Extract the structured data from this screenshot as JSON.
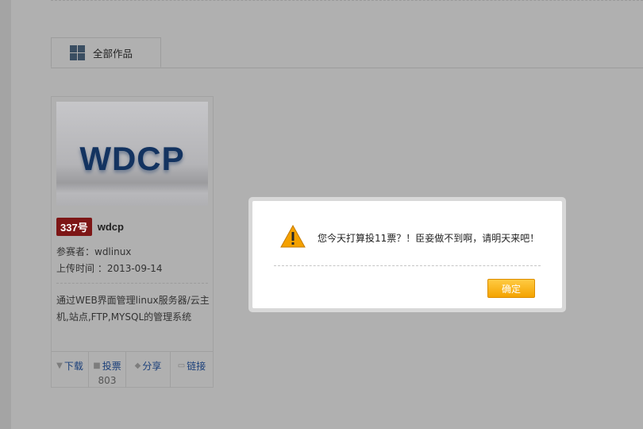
{
  "tab": {
    "label": "全部作品",
    "icon": "grid-icon"
  },
  "work": {
    "thumbnail_text": "WDCP",
    "number_badge": "337号",
    "name": "wdcp",
    "entrant": "参赛者：wdlinux",
    "upload_time": "上传时间 ：2013-09-14",
    "description": "通过WEB界面管理linux服务器/云主机,站点,FTP,MYSQL的管理系统",
    "actions": [
      {
        "label": "下载",
        "icon": "download-icon"
      },
      {
        "label": "投票",
        "icon": "vote-icon",
        "count": "803"
      },
      {
        "label": "分享",
        "icon": "share-icon"
      },
      {
        "label": "链接",
        "icon": "link-icon"
      }
    ]
  },
  "dialog": {
    "icon": "warning-icon",
    "message": "您今天打算投11票？！臣妾做不到啊，请明天来吧！",
    "confirm_label": "确定"
  },
  "colors": {
    "overlay": "#b0b0b0",
    "badge": "#7d1616",
    "link": "#1a3f7a",
    "confirm_button": "#f4a300",
    "warning": "#f5a100"
  }
}
